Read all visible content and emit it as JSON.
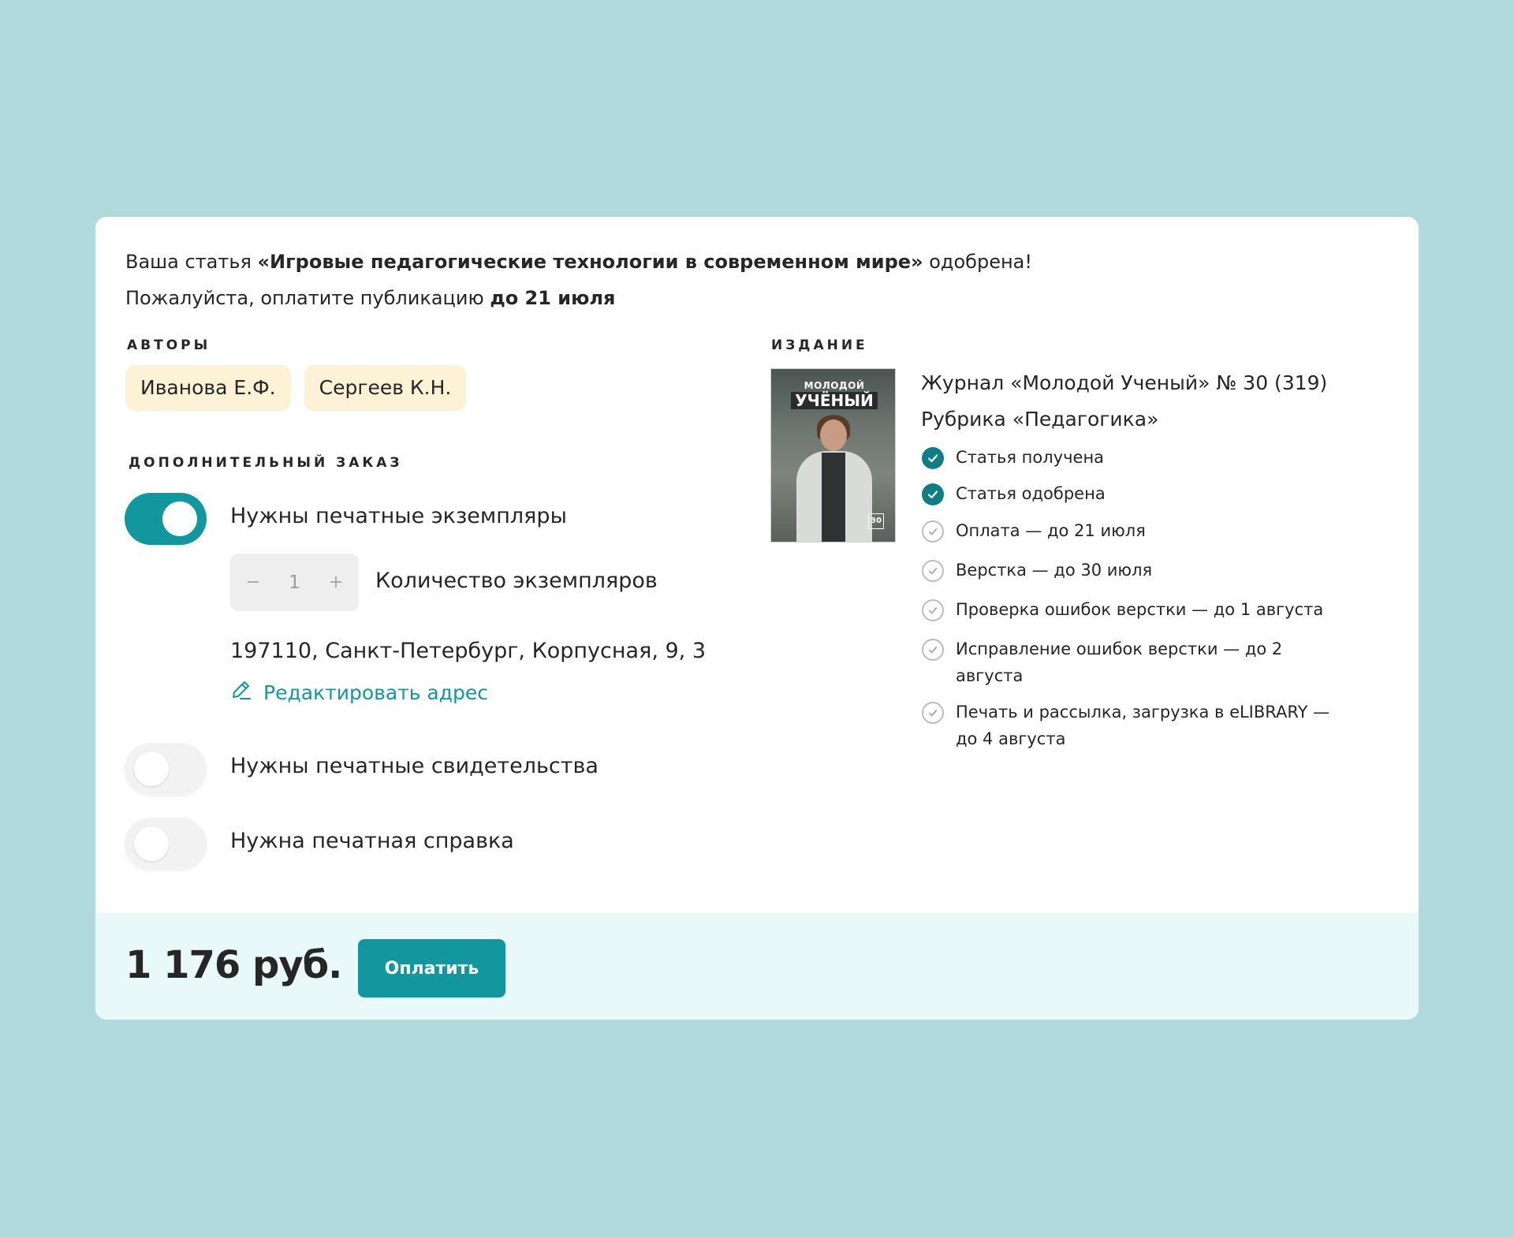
{
  "intro": {
    "line1_prefix": "Ваша статья ",
    "article_title": "«Игровые педагогические технологии в современном мире»",
    "line1_suffix": " одобрена!",
    "line2_prefix": "Пожалуйста, оплатите публикацию ",
    "deadline": "до 21 июля"
  },
  "authors": {
    "label": "АВТОРЫ",
    "items": [
      "Иванова Е.Ф.",
      "Сергеев К.Н."
    ]
  },
  "extra_order": {
    "label": "ДОПОЛНИТЕЛЬНЫЙ ЗАКАЗ",
    "print_copies": {
      "label": "Нужны печатные экземпляры",
      "enabled": true
    },
    "quantity": {
      "minus": "−",
      "value": "1",
      "plus": "+",
      "label": "Количество экземпляров"
    },
    "address": "197110, Санкт-Петербург, Корпусная, 9, 3",
    "edit_address": "Редактировать адрес",
    "certificates": {
      "label": "Нужны печатные свидетельства",
      "enabled": false
    },
    "reference": {
      "label": "Нужна печатная справка",
      "enabled": false
    }
  },
  "publication": {
    "label": "ИЗДАНИЕ",
    "cover": {
      "line1": "МОЛОДОЙ",
      "line2": "УЧЁНЫЙ",
      "badge": "30"
    },
    "journal": "Журнал «Молодой Ученый» № 30 (319)",
    "rubric": "Рубрика «Педагогика»",
    "statuses": [
      {
        "text": "Статья получена",
        "done": true
      },
      {
        "text": "Статья одобрена",
        "done": true
      },
      {
        "text": "Оплата — до 21 июля",
        "done": false
      },
      {
        "text": "Верстка — до 30 июля",
        "done": false
      },
      {
        "text": "Проверка ошибок верстки — до 1 августа",
        "done": false
      },
      {
        "text": "Исправление ошибок верстки — до 2 августа",
        "done": false
      },
      {
        "text": "Печать и рассылка, загрузка в eLIBRARY — до 4 августа",
        "done": false
      }
    ]
  },
  "footer": {
    "price": "1 176 руб.",
    "pay_button": "Оплатить"
  },
  "colors": {
    "page_bg": "#b1dadd",
    "accent": "#13979f",
    "accent_dark": "#0f7e84",
    "chip_bg": "#fdf1d6",
    "footer_bg": "#e9f8f8"
  }
}
